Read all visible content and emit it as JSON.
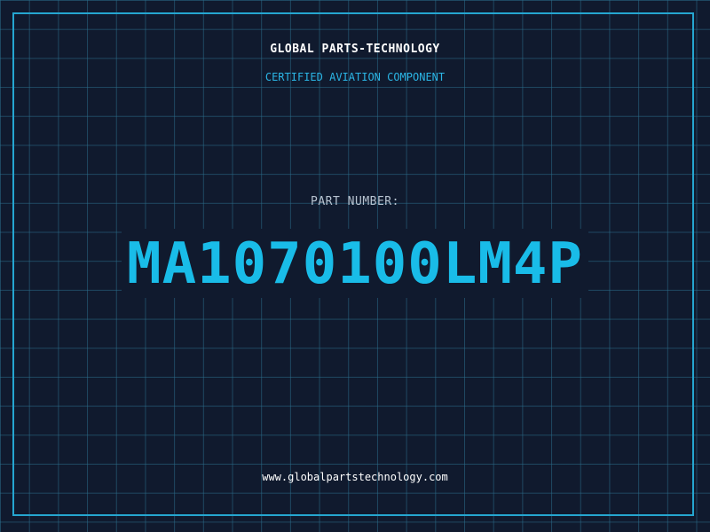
{
  "header": {
    "company_name": "GLOBAL PARTS-TECHNOLOGY",
    "tagline": "CERTIFIED AVIATION COMPONENT"
  },
  "part": {
    "label": "PART NUMBER:",
    "number": "MA1070100LM4P"
  },
  "footer": {
    "website": "www.globalpartstechnology.com"
  },
  "colors": {
    "background": "#101a2e",
    "grid": "#2b6e8c",
    "accent": "#19bce8",
    "frame": "#25a6d0"
  }
}
